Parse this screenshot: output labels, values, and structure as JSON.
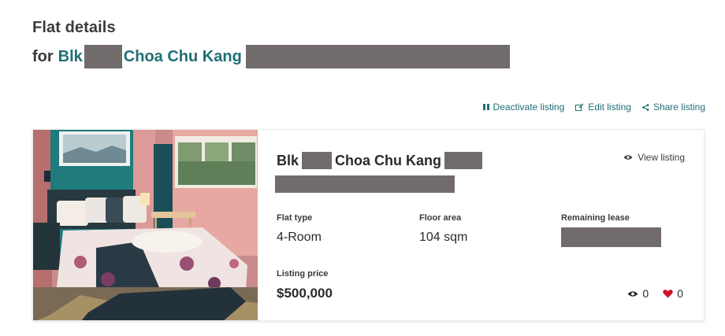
{
  "header": {
    "title": "Flat details",
    "subtitle_prefix": "for",
    "subtitle_blk": "Blk",
    "subtitle_street": "Choa Chu Kang"
  },
  "actions": {
    "deactivate": "Deactivate listing",
    "edit": "Edit listing",
    "share": "Share listing"
  },
  "listing": {
    "title_blk": "Blk",
    "title_street": "Choa Chu Kang",
    "view_label": "View listing",
    "flat_type_label": "Flat type",
    "flat_type": "4-Room",
    "floor_area_label": "Floor area",
    "floor_area": "104 sqm",
    "remaining_lease_label": "Remaining lease",
    "listing_price_label": "Listing price",
    "listing_price": "$500,000",
    "views": "0",
    "likes": "0"
  },
  "colors": {
    "link": "#1f6f75",
    "redaction": "#716b6c",
    "heart": "#d0122b"
  },
  "icons": {
    "deactivate": "pause-icon",
    "edit": "edit-icon",
    "share": "share-icon",
    "view": "eye-icon",
    "views": "eye-icon",
    "likes": "heart-icon"
  }
}
